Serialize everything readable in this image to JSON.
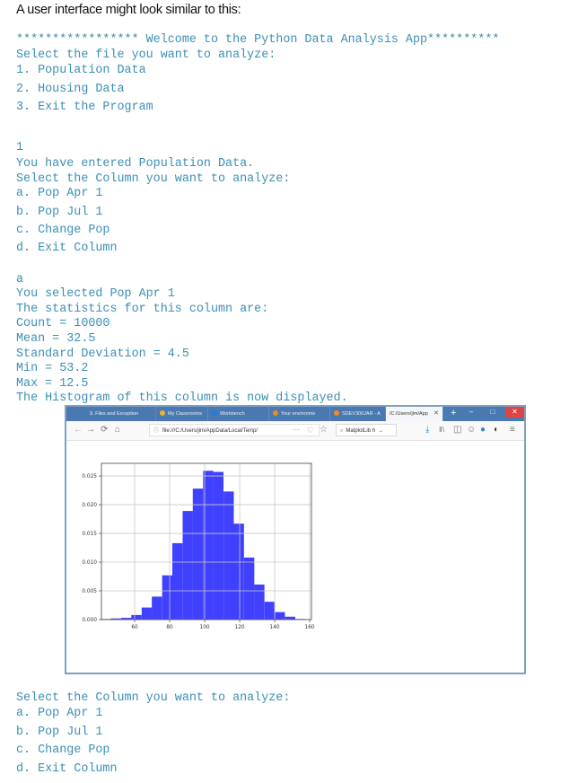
{
  "intro": "A user interface might look similar to this:",
  "console_top": [
    "***************** Welcome to the Python Data Analysis App**********",
    "Select the file you want to analyze:",
    "1. Population Data",
    "2. Housing Data",
    "3. Exit the Program"
  ],
  "console_mid": [
    "1",
    "You have entered Population Data.",
    "Select the Column you want to analyze:",
    "a. Pop Apr 1",
    "b. Pop Jul 1",
    "c. Change Pop",
    "d. Exit Column"
  ],
  "console_stats": [
    "a",
    "You selected Pop Apr 1",
    "The statistics for this column are:",
    "Count = 10000",
    "Mean = 32.5",
    "Standard Deviation = 4.5",
    "Min = 53.2",
    "Max = 12.5",
    "The Histogram of this column is now displayed."
  ],
  "console_bottom": [
    "Select the Column you want to analyze:",
    "a. Pop Apr 1",
    "b. Pop Jul 1",
    "c. Change Pop",
    "d. Exit Column"
  ],
  "browser": {
    "tabs": [
      {
        "label": "9. Files and Exception",
        "favicon_color": "#4a78b0",
        "active": false
      },
      {
        "label": "My Classrooms",
        "favicon_color": "#f0b429",
        "active": false
      },
      {
        "label": "Workbench",
        "favicon_color": "#2b7bd6",
        "active": false
      },
      {
        "label": "Your environme",
        "favicon_color": "#f08a24",
        "active": false
      },
      {
        "label": "SDEV300JAR - A",
        "favicon_color": "#f08a24",
        "active": false
      },
      {
        "label": "/C:/Users/jim/App",
        "favicon_color": "",
        "active": true
      }
    ],
    "new_tab": "+",
    "url": "file:///C:/Users/jim/AppData/Local/Temp/",
    "search_text": "MatplotLib h",
    "page_actions": "···",
    "icons": {
      "back": "←",
      "forward": "→",
      "reload": "⟳",
      "home": "⌂",
      "info": "ⓘ",
      "pocket": "♡",
      "star": "☆",
      "search": "⌕",
      "go": "→",
      "download": "⤓",
      "library": "Ⅱ\\",
      "sidebar": "◫",
      "account": "☺",
      "ext1": "●",
      "ext2": "◐",
      "menu": "≡",
      "minimize": "–",
      "maximize": "□",
      "close": "✕",
      "tab_close": "✕"
    }
  },
  "chart_data": {
    "type": "bar",
    "title": "",
    "xlabel": "",
    "ylabel": "",
    "bar_color": "#3030ff",
    "grid": true,
    "xlim": [
      41,
      161
    ],
    "ylim": [
      0,
      0.0272
    ],
    "xticks": [
      60,
      80,
      100,
      120,
      140,
      160
    ],
    "yticks": [
      0.0,
      0.005,
      0.01,
      0.015,
      0.02,
      0.025
    ],
    "ytick_labels": [
      "0.000",
      "0.005",
      "0.010",
      "0.015",
      "0.020",
      "0.025"
    ],
    "xtick_labels": [
      "60",
      "80",
      "100",
      "120",
      "140",
      "160"
    ],
    "bin_width": 5.85,
    "bin_starts": [
      40.6,
      46.4,
      52.3,
      58.1,
      64.0,
      69.8,
      75.7,
      81.5,
      87.4,
      93.2,
      99.1,
      104.9,
      110.8,
      116.6,
      122.5,
      128.3,
      134.2,
      140.0,
      145.9,
      151.7
    ],
    "values": [
      0.0001,
      0.0002,
      0.0003,
      0.0008,
      0.0021,
      0.004,
      0.0077,
      0.0133,
      0.0189,
      0.0228,
      0.0259,
      0.0257,
      0.0223,
      0.0167,
      0.0108,
      0.0061,
      0.0031,
      0.0013,
      0.0005,
      0.0001
    ]
  }
}
